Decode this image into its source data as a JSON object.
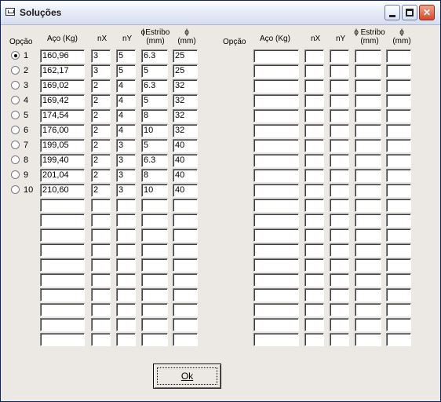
{
  "window": {
    "title": "Soluções",
    "buttons": {
      "minimize": "minimize",
      "maximize": "maximize",
      "close": "✕"
    }
  },
  "left_table": {
    "headers": {
      "option": "Opção",
      "steel": "Aço (Kg)",
      "nx": "nX",
      "ny": "nY",
      "stirrup_1": "ϕEstribo",
      "stirrup_2": "(mm)",
      "phi_1": "ϕ",
      "phi_2": "(mm)"
    },
    "options": [
      {
        "label": "1",
        "selected": true
      },
      {
        "label": "2",
        "selected": false
      },
      {
        "label": "3",
        "selected": false
      },
      {
        "label": "4",
        "selected": false
      },
      {
        "label": "5",
        "selected": false
      },
      {
        "label": "6",
        "selected": false
      },
      {
        "label": "7",
        "selected": false
      },
      {
        "label": "8",
        "selected": false
      },
      {
        "label": "9",
        "selected": false
      },
      {
        "label": "10",
        "selected": false
      }
    ],
    "rows": [
      [
        "160,96",
        "3",
        "5",
        "6.3",
        "25"
      ],
      [
        "162,17",
        "3",
        "5",
        "5",
        "25"
      ],
      [
        "169,02",
        "2",
        "4",
        "6.3",
        "32"
      ],
      [
        "169,42",
        "2",
        "4",
        "5",
        "32"
      ],
      [
        "174,54",
        "2",
        "4",
        "8",
        "32"
      ],
      [
        "176,00",
        "2",
        "4",
        "10",
        "32"
      ],
      [
        "199,05",
        "2",
        "3",
        "5",
        "40"
      ],
      [
        "199,40",
        "2",
        "3",
        "6.3",
        "40"
      ],
      [
        "201,04",
        "2",
        "3",
        "8",
        "40"
      ],
      [
        "210,60",
        "2",
        "3",
        "10",
        "40"
      ],
      [
        "",
        "",
        "",
        "",
        ""
      ],
      [
        "",
        "",
        "",
        "",
        ""
      ],
      [
        "",
        "",
        "",
        "",
        ""
      ],
      [
        "",
        "",
        "",
        "",
        ""
      ],
      [
        "",
        "",
        "",
        "",
        ""
      ],
      [
        "",
        "",
        "",
        "",
        ""
      ],
      [
        "",
        "",
        "",
        "",
        ""
      ],
      [
        "",
        "",
        "",
        "",
        ""
      ],
      [
        "",
        "",
        "",
        "",
        ""
      ],
      [
        "",
        "",
        "",
        "",
        ""
      ]
    ]
  },
  "right_table": {
    "headers": {
      "option": "Opção",
      "steel": "Aço (Kg)",
      "nx": "nX",
      "ny": "nY",
      "stirrup_1": "ϕ Estribo",
      "stirrup_2": "(mm)",
      "phi_1": "ϕ",
      "phi_2": "(mm)"
    },
    "rows": [
      [
        "",
        "",
        "",
        "",
        ""
      ],
      [
        "",
        "",
        "",
        "",
        ""
      ],
      [
        "",
        "",
        "",
        "",
        ""
      ],
      [
        "",
        "",
        "",
        "",
        ""
      ],
      [
        "",
        "",
        "",
        "",
        ""
      ],
      [
        "",
        "",
        "",
        "",
        ""
      ],
      [
        "",
        "",
        "",
        "",
        ""
      ],
      [
        "",
        "",
        "",
        "",
        ""
      ],
      [
        "",
        "",
        "",
        "",
        ""
      ],
      [
        "",
        "",
        "",
        "",
        ""
      ],
      [
        "",
        "",
        "",
        "",
        ""
      ],
      [
        "",
        "",
        "",
        "",
        ""
      ],
      [
        "",
        "",
        "",
        "",
        ""
      ],
      [
        "",
        "",
        "",
        "",
        ""
      ],
      [
        "",
        "",
        "",
        "",
        ""
      ],
      [
        "",
        "",
        "",
        "",
        ""
      ],
      [
        "",
        "",
        "",
        "",
        ""
      ],
      [
        "",
        "",
        "",
        "",
        ""
      ],
      [
        "",
        "",
        "",
        "",
        ""
      ],
      [
        "",
        "",
        "",
        "",
        ""
      ]
    ]
  },
  "ok_button": {
    "label": "Ok"
  }
}
